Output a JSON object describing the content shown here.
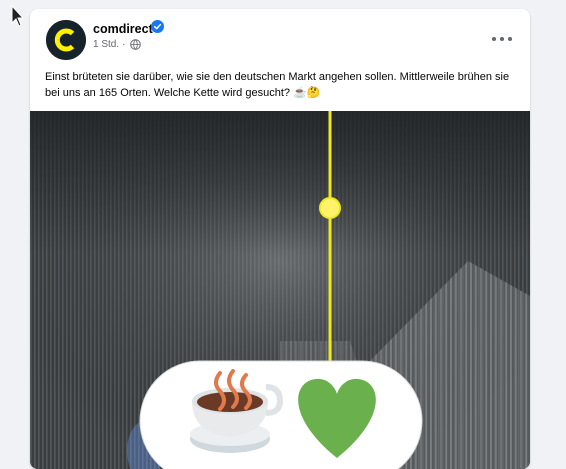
{
  "post": {
    "author": "comdirect",
    "timestamp": "1 Std.",
    "separator": "·",
    "text": "Einst brüteten sie darüber, wie sie den deutschen Markt angehen sollen. Mittlerweile brühen sie bei uns an 165 Orten. Welche Kette wird gesucht? ☕🤔"
  },
  "icons": {
    "avatar": "comdirect-logo",
    "verified": "verified-badge-icon",
    "privacy": "globe-icon",
    "menu": "more-options-icon",
    "cursor": "mouse-pointer-icon",
    "image_emojis": [
      "hot-beverage-icon",
      "green-heart-icon"
    ]
  },
  "colors": {
    "brand_yellow": "#fff200",
    "brand_dark": "#16232b",
    "verified_blue": "#1877f2",
    "heart_green": "#6ab04c"
  }
}
